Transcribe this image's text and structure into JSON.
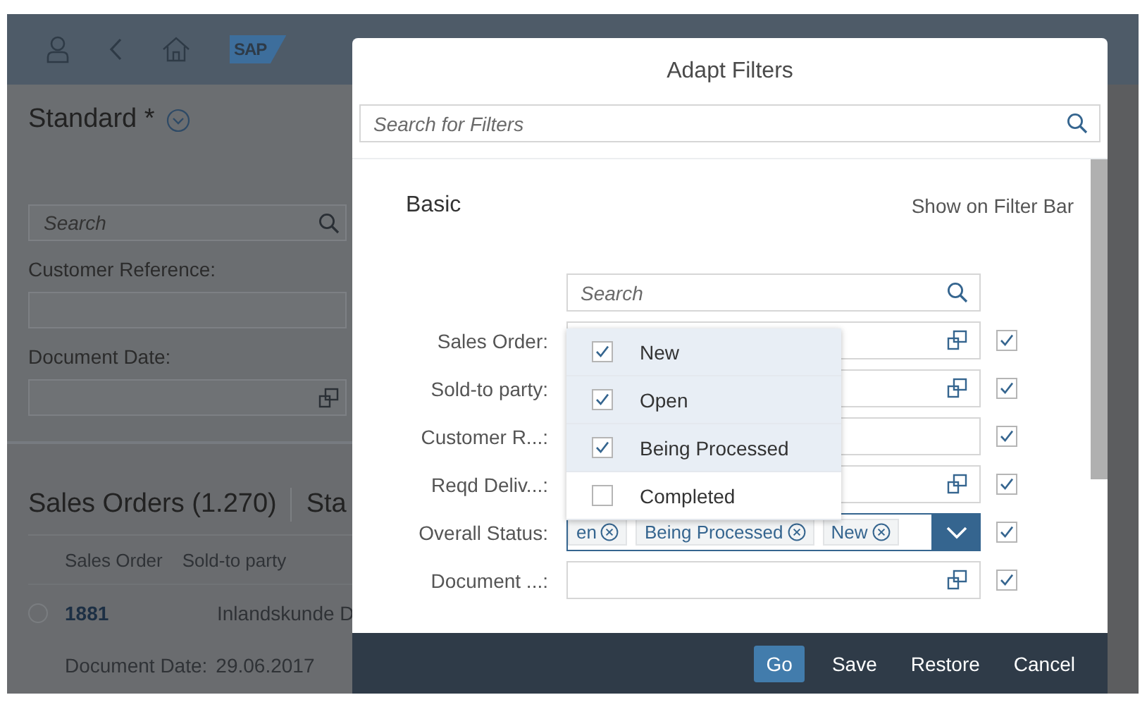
{
  "app_header": {
    "logo": "SAP"
  },
  "variant": {
    "title": "Standard *"
  },
  "filter_bar": {
    "search": {
      "placeholder": "Search"
    },
    "fields": [
      {
        "label": "Customer Reference:",
        "value_help": false
      },
      {
        "label": "Document Date:",
        "value_help": true
      }
    ]
  },
  "table": {
    "title": "Sales Orders (1.270)",
    "title_2": "Sta",
    "columns": [
      "Sales Order",
      "Sold-to party"
    ],
    "rows": [
      {
        "selected": false,
        "cells": [
          "1881",
          "Inlandskunde D"
        ],
        "detail_label": "Document Date:",
        "detail_value": "29.06.2017"
      }
    ]
  },
  "dialog": {
    "title": "Adapt Filters",
    "search": {
      "placeholder": "Search for Filters"
    },
    "group": "Basic",
    "column_header": "Show on Filter Bar",
    "field_search": {
      "placeholder": "Search"
    },
    "filters": [
      {
        "kind": "input",
        "label": "Sales Order:",
        "value_help": true,
        "show_on_bar": true
      },
      {
        "kind": "input",
        "label": "Sold-to party:",
        "value_help": true,
        "show_on_bar": true
      },
      {
        "kind": "input",
        "label": "Customer R...:",
        "value_help": false,
        "show_on_bar": true
      },
      {
        "kind": "input",
        "label": "Reqd Deliv...:",
        "value_help": true,
        "show_on_bar": true
      },
      {
        "kind": "multi",
        "label": "Overall Status:",
        "tokens": [
          "en",
          "Being Processed",
          "New"
        ],
        "show_on_bar": true
      },
      {
        "kind": "input",
        "label": "Document ...:",
        "value_help": true,
        "show_on_bar": true
      }
    ],
    "dropdown": {
      "items": [
        {
          "label": "New",
          "checked": true,
          "selected": true
        },
        {
          "label": "Open",
          "checked": true,
          "selected": true
        },
        {
          "label": "Being Processed",
          "checked": true,
          "selected": true
        },
        {
          "label": "Completed",
          "checked": false,
          "selected": false
        }
      ]
    },
    "buttons": [
      {
        "label": "Go",
        "emphasized": true
      },
      {
        "label": "Save",
        "emphasized": false
      },
      {
        "label": "Restore",
        "emphasized": false
      },
      {
        "label": "Cancel",
        "emphasized": false
      }
    ]
  }
}
